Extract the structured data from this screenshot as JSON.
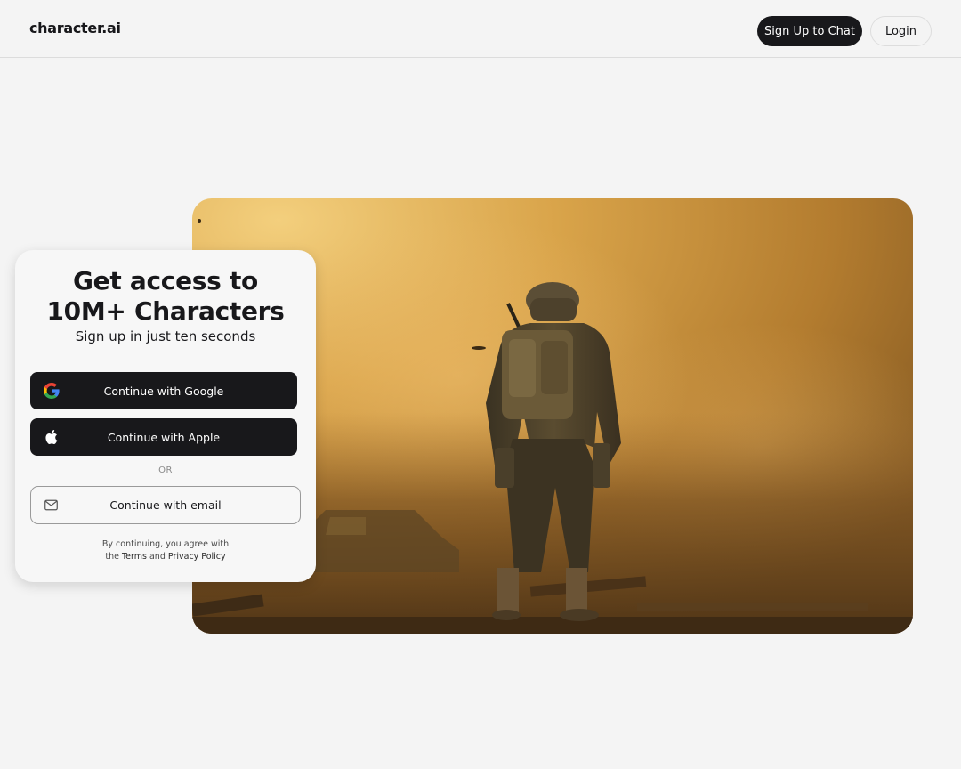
{
  "header": {
    "logo": "character.ai",
    "signup_label": "Sign Up to Chat",
    "login_label": "Login"
  },
  "hero": {
    "image_subject": "soldier standing in dusty battlefield"
  },
  "card": {
    "title_line1": "Get access to",
    "title_line2": "10M+ Characters",
    "subtitle": "Sign up in just ten seconds",
    "google_label": "Continue with Google",
    "apple_label": "Continue with Apple",
    "or_label": "OR",
    "email_label": "Continue with email",
    "legal_line1": "By continuing, you agree with",
    "legal_prefix": "the",
    "terms_label": "Terms",
    "legal_and": "and",
    "privacy_label": "Privacy Policy"
  },
  "icons": {
    "google": "google-icon",
    "apple": "apple-icon",
    "email": "mail-icon"
  }
}
